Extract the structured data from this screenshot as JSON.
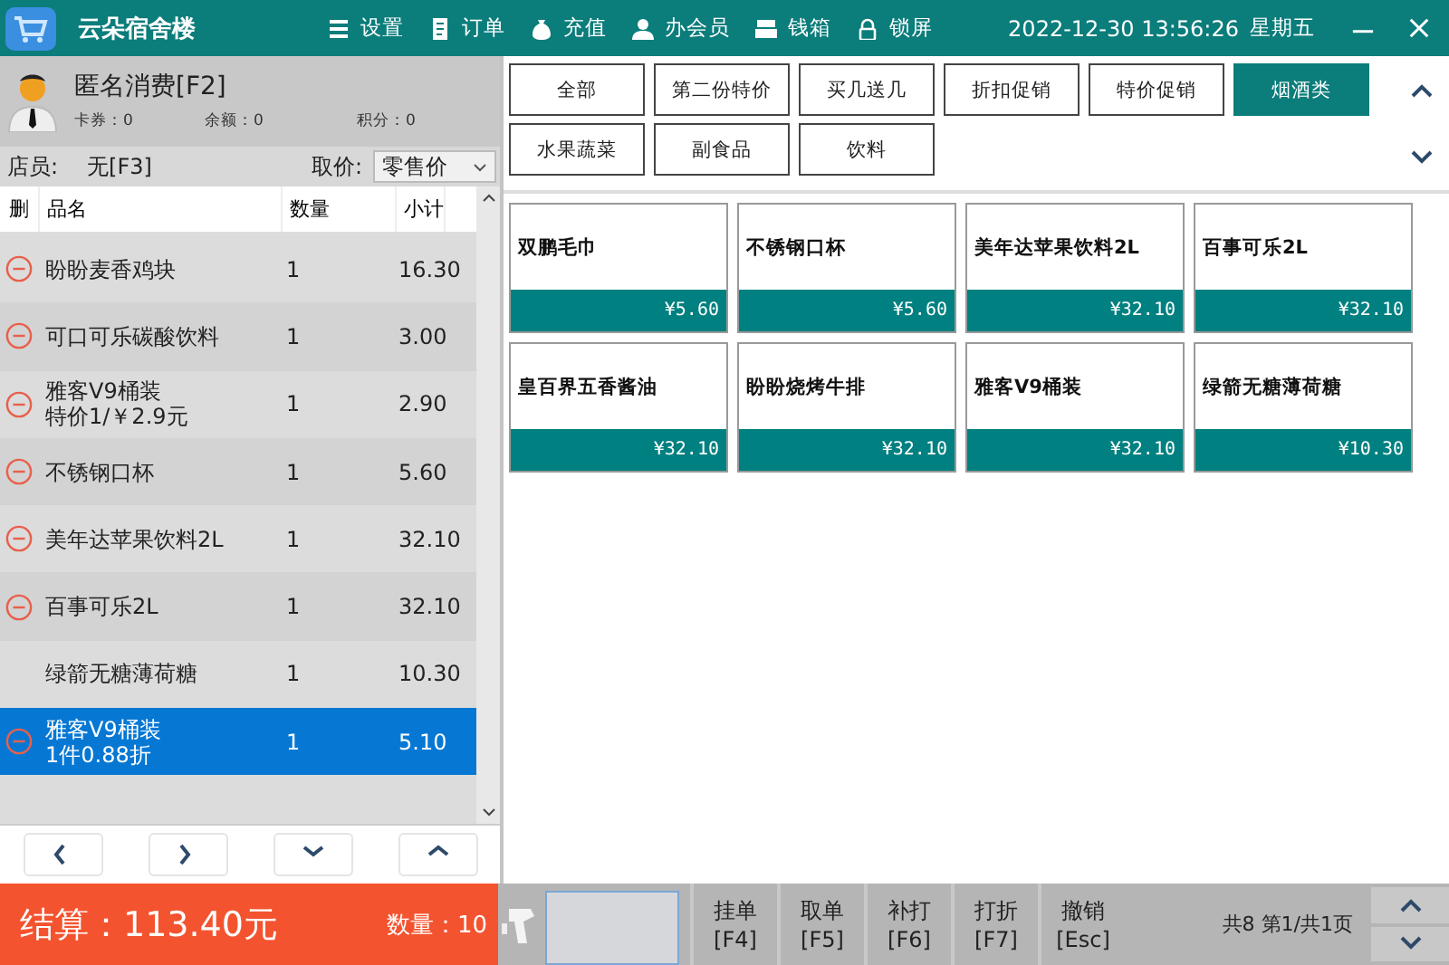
{
  "header": {
    "title": "云朵宿舍楼",
    "menu": [
      {
        "label": "设置"
      },
      {
        "label": "订单"
      },
      {
        "label": "充值"
      },
      {
        "label": "办会员"
      },
      {
        "label": "钱箱"
      },
      {
        "label": "锁屏"
      }
    ],
    "datetime": "2022-12-30 13:56:26",
    "weekday": "星期五"
  },
  "customer": {
    "name": "匿名消费[F2]",
    "stats": [
      "卡券：0",
      "余额：0",
      "积分：0"
    ]
  },
  "staff": {
    "label": "店员:",
    "value": "无[F3]",
    "price_label": "取价:",
    "price_value": "零售价"
  },
  "cart": {
    "columns": [
      "删",
      "品名",
      "数量",
      "小计"
    ],
    "rows": [
      {
        "name": "盼盼麦香鸡块",
        "qty": "1",
        "subtotal": "16.30",
        "deletable": true,
        "selected": false
      },
      {
        "name": "可口可乐碳酸饮料",
        "qty": "1",
        "subtotal": "3.00",
        "deletable": true,
        "selected": false
      },
      {
        "name": "雅客V9桶装",
        "note": "特价1/￥2.9元",
        "qty": "1",
        "subtotal": "2.90",
        "deletable": true,
        "selected": false
      },
      {
        "name": "不锈钢口杯",
        "qty": "1",
        "subtotal": "5.60",
        "deletable": true,
        "selected": false
      },
      {
        "name": "美年达苹果饮料2L",
        "qty": "1",
        "subtotal": "32.10",
        "deletable": true,
        "selected": false
      },
      {
        "name": "百事可乐2L",
        "qty": "1",
        "subtotal": "32.10",
        "deletable": true,
        "selected": false
      },
      {
        "name": "绿箭无糖薄荷糖",
        "qty": "1",
        "subtotal": "10.30",
        "deletable": false,
        "selected": false
      },
      {
        "name": "雅客V9桶装",
        "note": "1件0.88折",
        "qty": "1",
        "subtotal": "5.10",
        "deletable": true,
        "selected": true
      }
    ]
  },
  "summary": {
    "total": "结算：113.40元",
    "count": "数量：10"
  },
  "actions": [
    {
      "label": "挂单",
      "key": "[F4]"
    },
    {
      "label": "取单",
      "key": "[F5]"
    },
    {
      "label": "补打",
      "key": "[F6]"
    },
    {
      "label": "打折",
      "key": "[F7]"
    },
    {
      "label": "撤销",
      "key": "[Esc]"
    }
  ],
  "paging": "共8 第1/共1页",
  "categories": [
    {
      "label": "全部",
      "selected": false
    },
    {
      "label": "第二份特价",
      "selected": false
    },
    {
      "label": "买几送几",
      "selected": false
    },
    {
      "label": "折扣促销",
      "selected": false
    },
    {
      "label": "特价促销",
      "selected": false
    },
    {
      "label": "烟酒类",
      "selected": true
    },
    {
      "label": "水果蔬菜",
      "selected": false
    },
    {
      "label": "副食品",
      "selected": false
    },
    {
      "label": "饮料",
      "selected": false
    }
  ],
  "products": [
    {
      "name": "双鹏毛巾",
      "price": "¥5.60"
    },
    {
      "name": "不锈钢口杯",
      "price": "¥5.60"
    },
    {
      "name": "美年达苹果饮料2L",
      "price": "¥32.10"
    },
    {
      "name": "百事可乐2L",
      "price": "¥32.10"
    },
    {
      "name": "皇百界五香酱油",
      "price": "¥32.10"
    },
    {
      "name": "盼盼烧烤牛排",
      "price": "¥32.10"
    },
    {
      "name": "雅客V9桶装",
      "price": "¥32.10"
    },
    {
      "name": "绿箭无糖薄荷糖",
      "price": "¥10.30"
    }
  ]
}
